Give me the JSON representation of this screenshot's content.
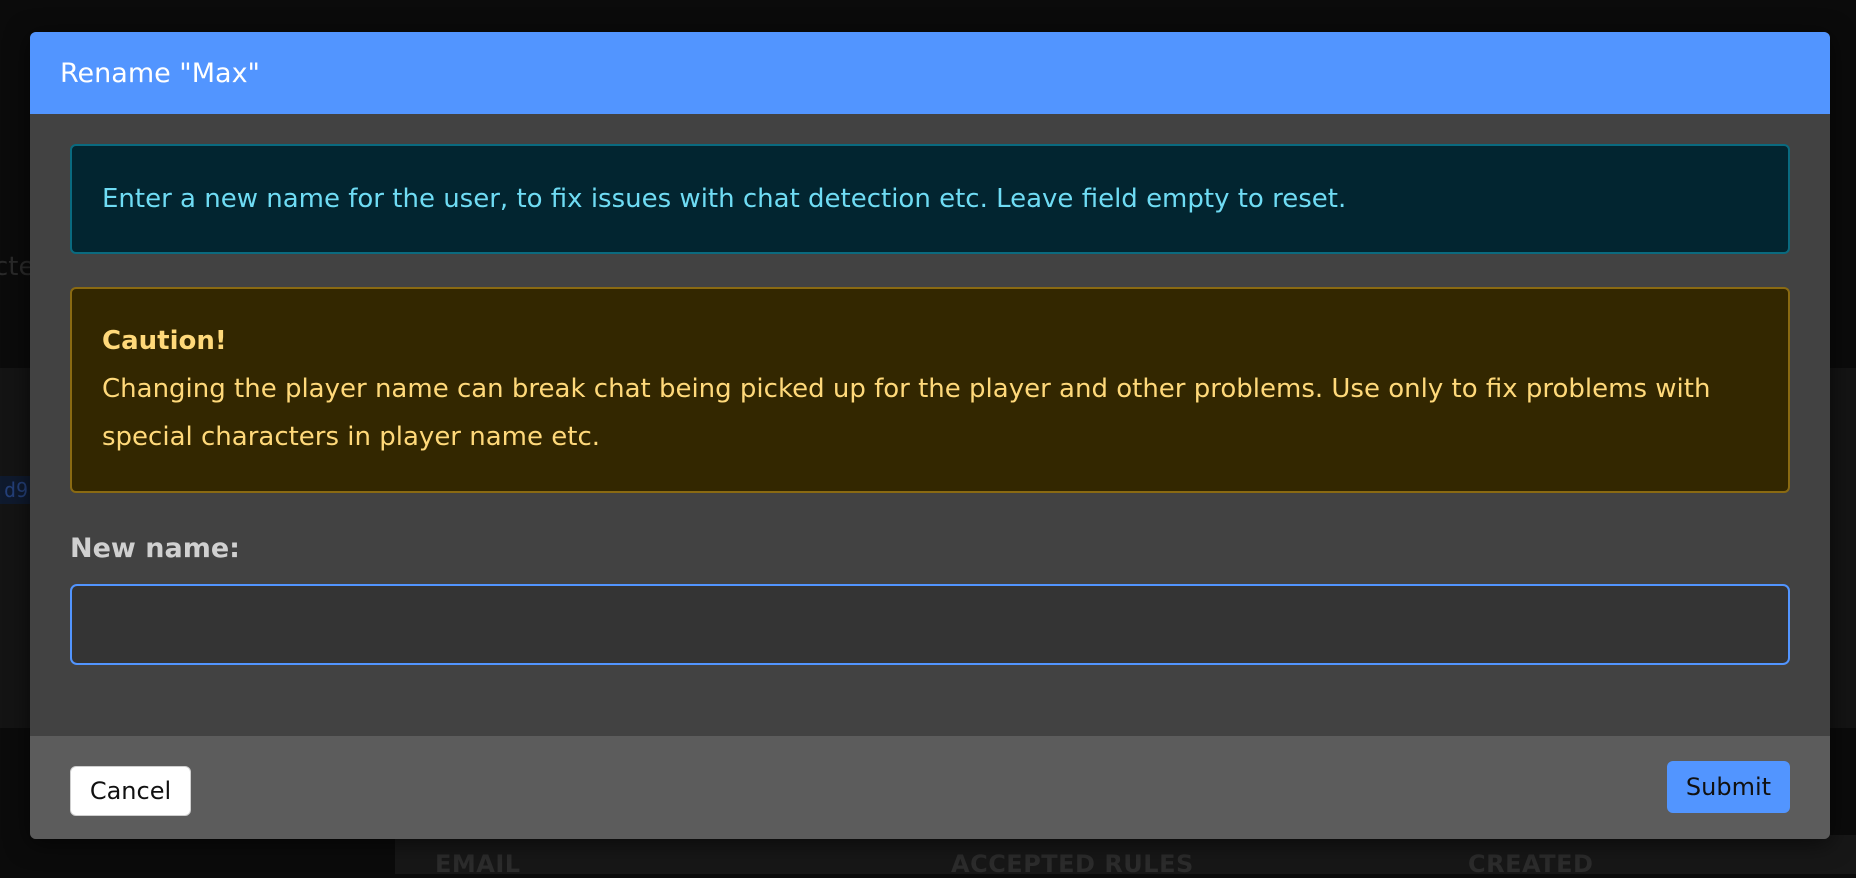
{
  "background": {
    "partial_text_left": "cte",
    "partial_code_left": "d9",
    "columns": [
      "EMAIL",
      "ACCEPTED RULES",
      "CREATED"
    ]
  },
  "modal": {
    "title": "Rename \"Max\"",
    "info_text": "Enter a new name for the user, to fix issues with chat detection etc. Leave field empty to reset.",
    "warning_title": "Caution!",
    "warning_text": "Changing the player name can break chat being picked up for the player and other problems. Use only to fix problems with special characters in player name etc.",
    "field_label": "New name:",
    "input_value": "",
    "input_placeholder": "",
    "cancel_label": "Cancel",
    "submit_label": "Submit"
  },
  "colors": {
    "header": "#5295ff",
    "info_text": "#6fdcf4",
    "warning_text": "#ffd97a",
    "submit_button": "#5295ff"
  }
}
